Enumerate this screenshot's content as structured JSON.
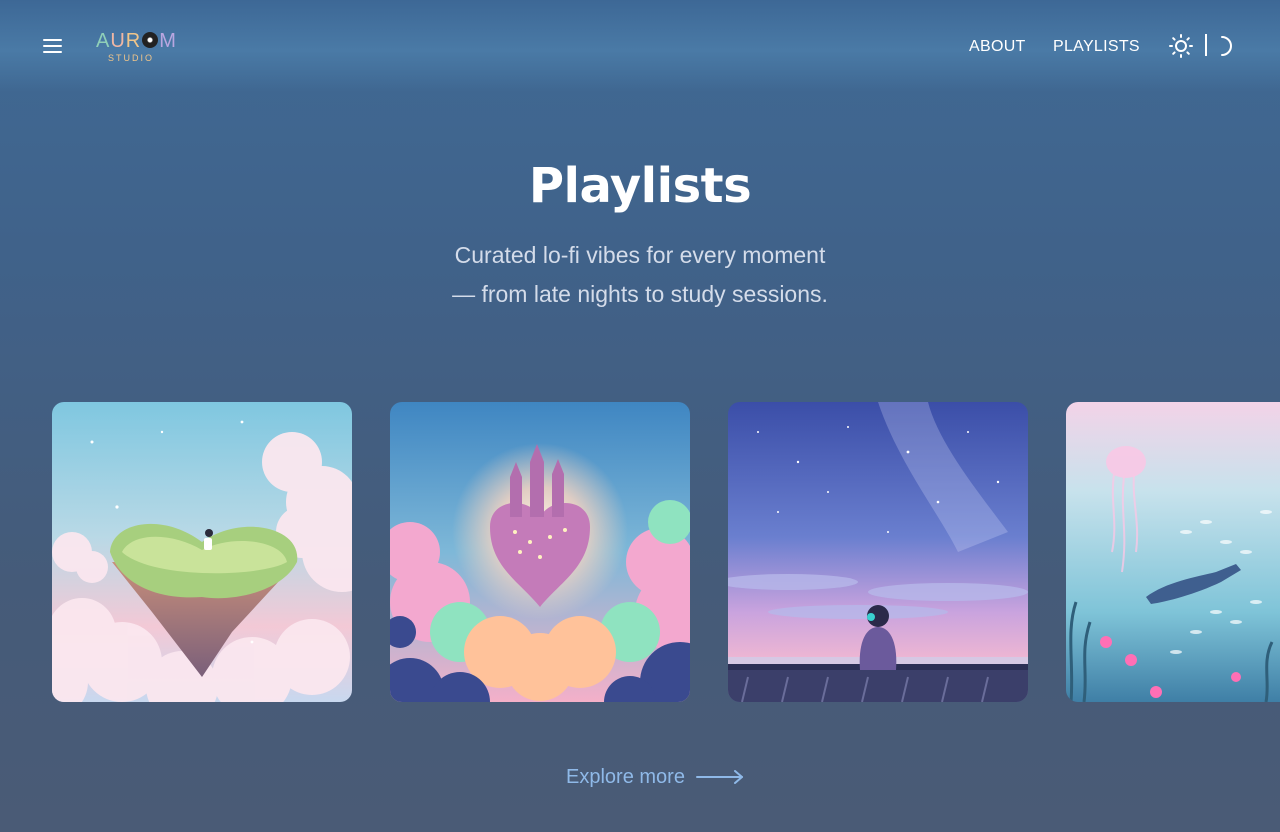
{
  "header": {
    "logo": {
      "word": "AURUM",
      "sub": "STUDIO"
    },
    "nav": [
      {
        "label": "ABOUT"
      },
      {
        "label": "PLAYLISTS"
      }
    ],
    "theme_icons": [
      "sun-icon",
      "moon-icon"
    ],
    "menu_icon": "hamburger-menu-icon"
  },
  "main": {
    "title": "Playlists",
    "subtitle_line1": "Curated lo-fi vibes for every moment",
    "subtitle_line2": "— from late nights to study sessions.",
    "playlists": [
      {
        "art": "floating heart island in pastel clouds"
      },
      {
        "art": "floating castle in glowing sunset clouds"
      },
      {
        "art": "person watching milky way over city lights"
      },
      {
        "art": "swimmer with jellyfish and fish underwater"
      }
    ],
    "explore_label": "Explore more"
  },
  "colors": {
    "background_top": "#3f6a95",
    "background_bottom": "#4a5b76",
    "link_accent": "#8fb9e8",
    "subtitle": "#d4dcea"
  }
}
